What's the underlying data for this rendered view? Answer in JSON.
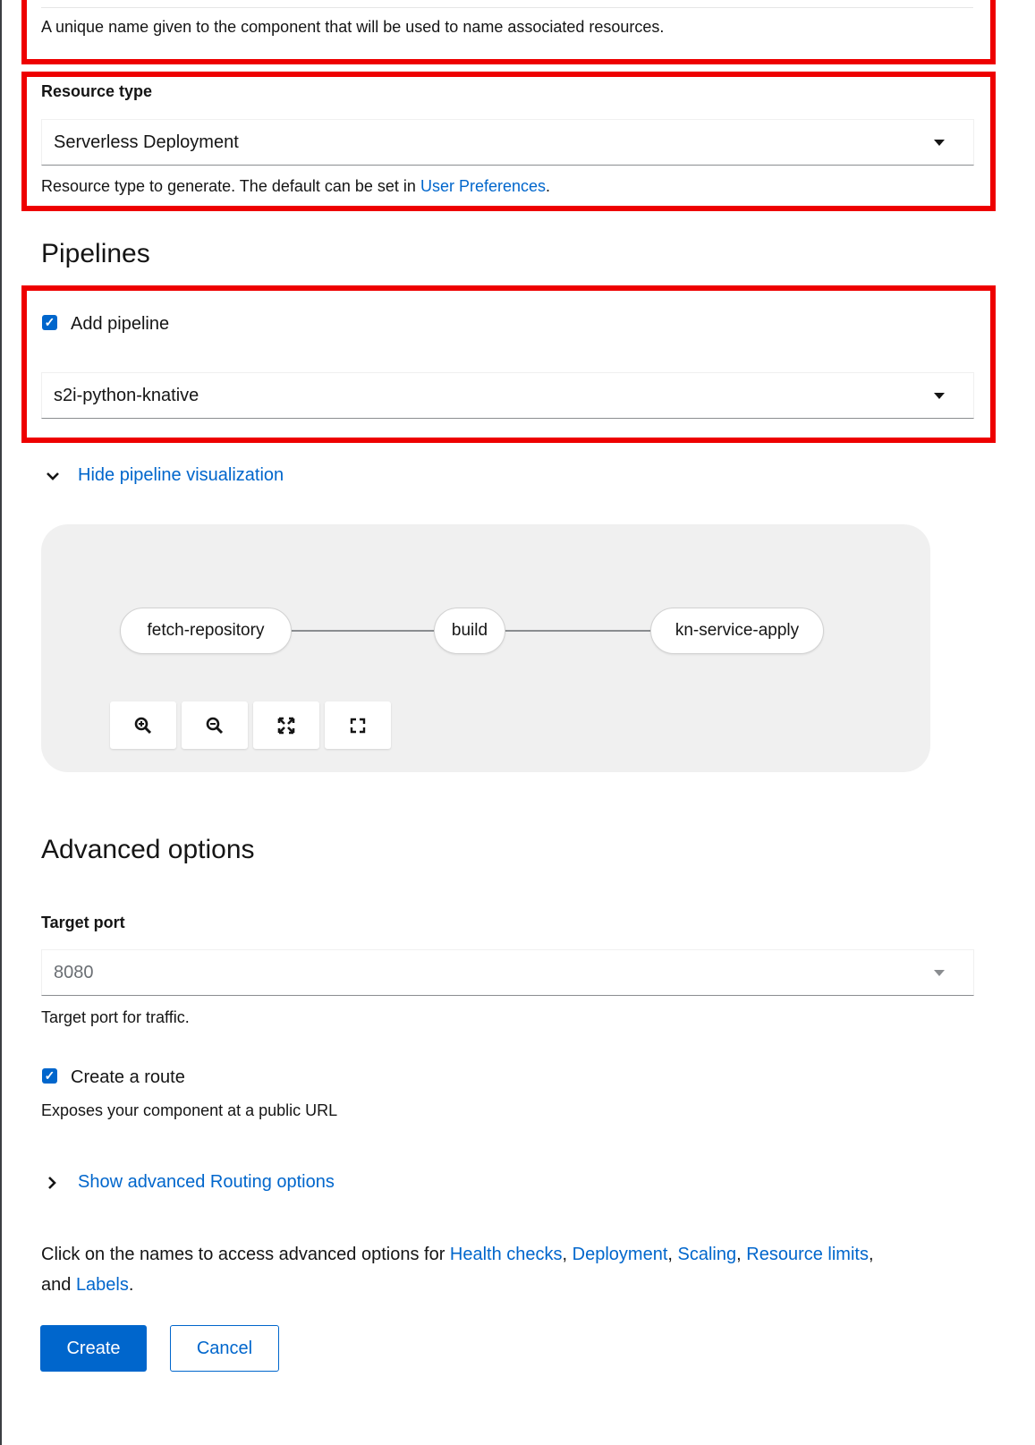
{
  "name_field": {
    "helper": "A unique name given to the component that will be used to name associated resources."
  },
  "resource_type": {
    "label": "Resource type",
    "value": "Serverless Deployment",
    "helper_prefix": "Resource type to generate. The default can be set in ",
    "helper_link": "User Preferences",
    "helper_suffix": "."
  },
  "pipelines": {
    "heading": "Pipelines",
    "add_pipeline_label": "Add pipeline",
    "add_pipeline_checked": true,
    "selected_pipeline": "s2i-python-knative",
    "toggle_label": "Hide pipeline visualization",
    "visualization": {
      "tasks": [
        "fetch-repository",
        "build",
        "kn-service-apply"
      ],
      "controls": [
        "zoom-in-icon",
        "zoom-out-icon",
        "fit-to-screen-icon",
        "expand-icon"
      ]
    }
  },
  "advanced": {
    "heading": "Advanced options",
    "target_port_label": "Target port",
    "target_port_placeholder": "8080",
    "target_port_helper": "Target port for traffic.",
    "create_route_label": "Create a route",
    "create_route_checked": true,
    "create_route_helper": "Exposes your component at a public URL",
    "routing_toggle": "Show advanced Routing options",
    "options_text_prefix": "Click on the names to access advanced options for ",
    "links": [
      "Health checks",
      "Deployment",
      "Scaling",
      "Resource limits"
    ],
    "and_text": "and ",
    "labels_link": "Labels",
    "period": "."
  },
  "actions": {
    "create": "Create",
    "cancel": "Cancel"
  },
  "colors": {
    "accent": "#0066cc",
    "highlight": "#ee0000",
    "visualization_bg": "#f0f0f0"
  }
}
